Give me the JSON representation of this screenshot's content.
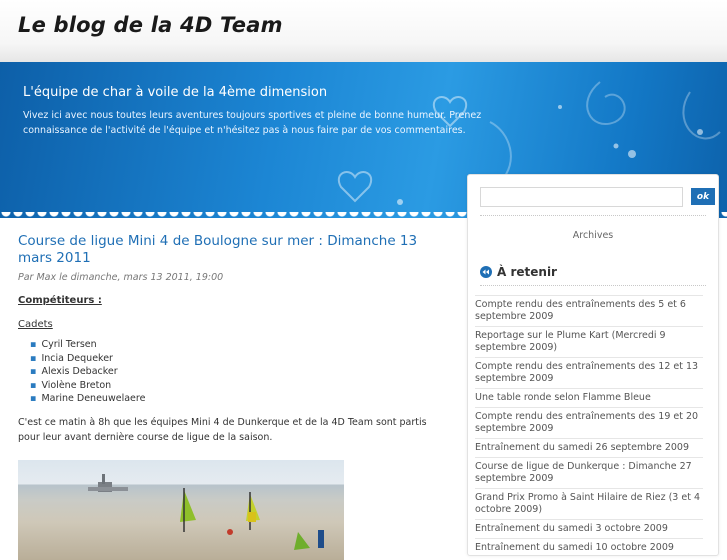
{
  "site": {
    "title": "Le blog de la 4D Team"
  },
  "banner": {
    "tagline": "L'équipe de char à voile de la 4ème dimension",
    "intro": "Vivez ici avec nous toutes leurs aventures toujours sportives et pleine de bonne humeur. Prenez connaissance de l'activité de l'équipe et n'hésitez pas à nous faire par de vos commentaires."
  },
  "post": {
    "title": "Course de ligue Mini 4 de Boulogne sur mer : Dimanche 13 mars 2011",
    "meta": "Par Max le dimanche, mars 13 2011, 19:00",
    "competitors_heading": "Compétiteurs :",
    "category": "Cadets",
    "competitors": [
      "Cyril Tersen",
      "Incia Dequeker",
      "Alexis Debacker",
      "Violène Breton",
      "Marine Deneuwelaere"
    ],
    "paragraph": "C'est ce matin à 8h que les équipes Mini 4 de Dunkerque et de la 4D Team sont partis pour leur avant dernière course de ligue de la saison."
  },
  "sidebar": {
    "search": {
      "value": "",
      "button": "ok"
    },
    "archives": "Archives",
    "retenir": {
      "title": "À retenir",
      "items": [
        "Compte rendu des entraînements des 5 et 6 septembre 2009",
        "Reportage sur le Plume Kart (Mercredi 9 septembre 2009)",
        "Compte rendu des entraînements des 12 et 13 septembre 2009",
        "Une table ronde selon Flamme Bleue",
        "Compte rendu des entraînements des 19 et 20 septembre 2009",
        "Entraînement du samedi 26 septembre 2009",
        "Course de ligue de Dunkerque : Dimanche 27 septembre 2009",
        "Grand Prix Promo à Saint Hilaire de Riez (3 et 4 octobre 2009)",
        "Entraînement du samedi 3 octobre 2009",
        "Entraînement du samedi 10 octobre 2009"
      ]
    }
  },
  "colors": {
    "accent": "#1f6fb5",
    "banner": "#1c86d4"
  },
  "icons": {
    "retenir": "arrow-circle-icon"
  }
}
